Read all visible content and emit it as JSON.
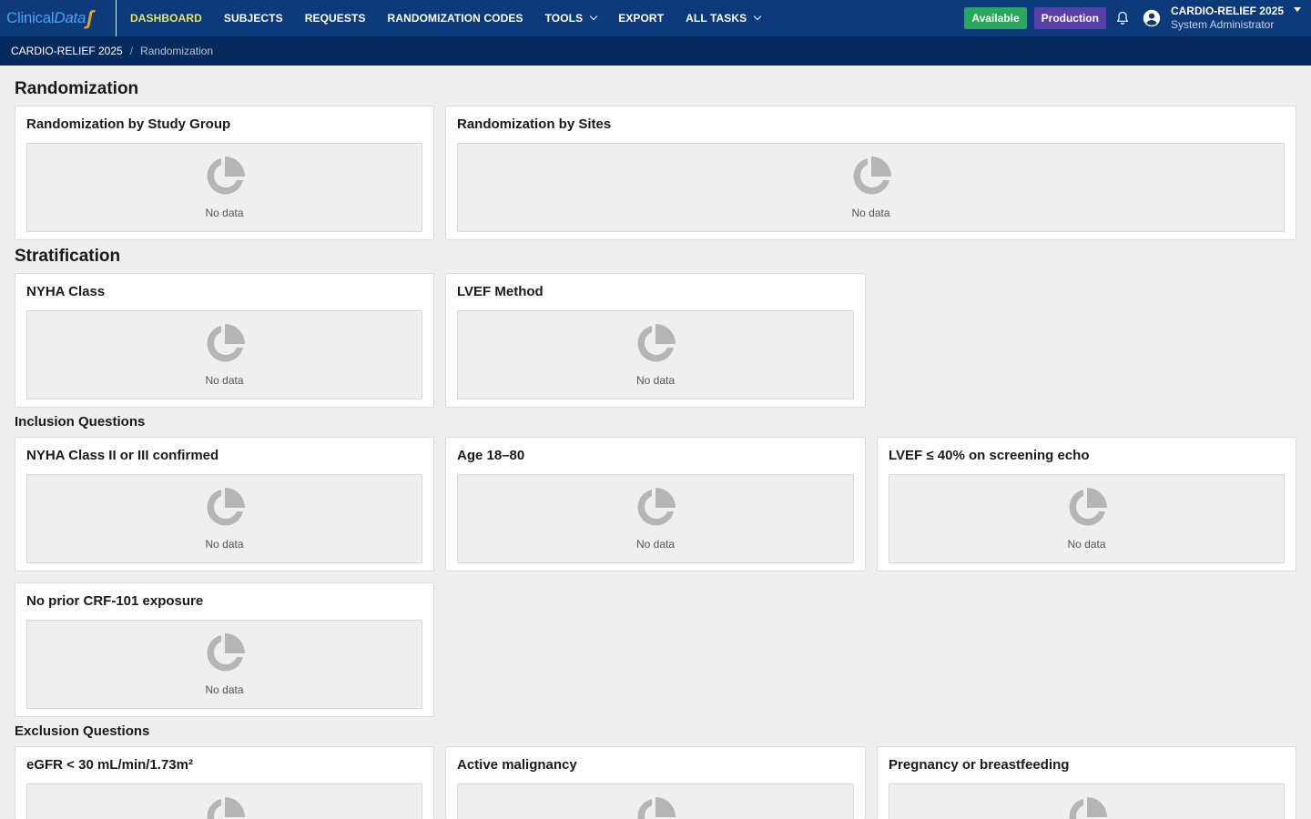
{
  "app": {
    "logo_part1": "Clinical",
    "logo_part2": "Data",
    "logo_mark": "ʃ"
  },
  "nav": {
    "items": [
      {
        "label": "DASHBOARD",
        "active": true
      },
      {
        "label": "SUBJECTS"
      },
      {
        "label": "REQUESTS"
      },
      {
        "label": "RANDOMIZATION CODES"
      },
      {
        "label": "TOOLS",
        "dropdown": true
      },
      {
        "label": "EXPORT"
      },
      {
        "label": "ALL TASKS",
        "dropdown": true
      }
    ]
  },
  "status": {
    "available": "Available",
    "environment": "Production"
  },
  "user": {
    "study": "CARDIO-RELIEF 2025",
    "role": "System Administrator"
  },
  "breadcrumb": {
    "study": "CARDIO-RELIEF 2025",
    "separator": "/",
    "page": "Randomization"
  },
  "colors": {
    "nav_bg": "#0d3a7a",
    "crumb_bg": "#072a5c",
    "active_nav": "#e2e85a",
    "available": "#27a85a",
    "production": "#5a3fa8",
    "placeholder_icon": "#b5b5b5"
  },
  "icons": {
    "notifications": "bell-icon",
    "user": "user-circle-icon",
    "chart_placeholder": "pie-chart-icon",
    "menu": "caret-down-icon"
  },
  "no_data_label": "No data",
  "sections": {
    "randomization": {
      "title": "Randomization",
      "cards": [
        "Randomization by Study Group",
        "Randomization by Sites"
      ]
    },
    "stratification": {
      "title": "Stratification",
      "cards": [
        "NYHA Class",
        "LVEF Method"
      ]
    },
    "inclusion": {
      "title": "Inclusion Questions",
      "cards": [
        "NYHA Class II or III confirmed",
        "Age 18–80",
        "LVEF ≤ 40% on screening echo",
        "No prior CRF-101 exposure"
      ]
    },
    "exclusion": {
      "title": "Exclusion Questions",
      "cards": [
        "eGFR < 30 mL/min/1.73m²",
        "Active malignancy",
        "Pregnancy or breastfeeding"
      ]
    }
  }
}
